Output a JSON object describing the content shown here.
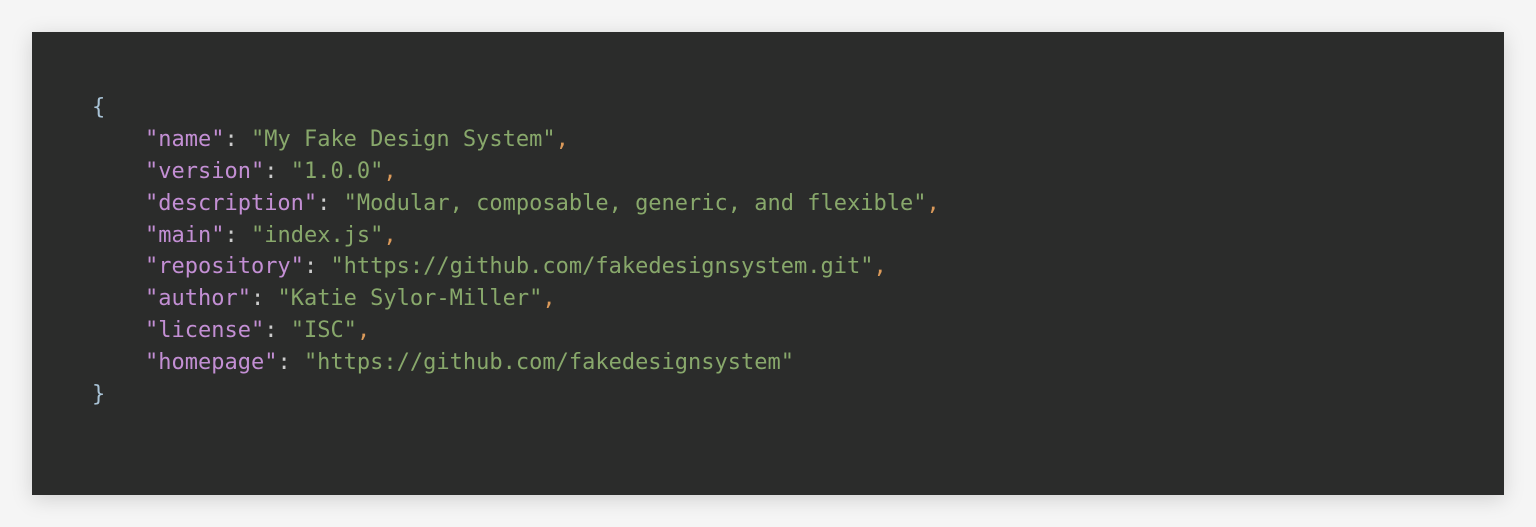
{
  "code": {
    "open_brace": "{",
    "close_brace": "}",
    "indent": "    ",
    "entries": [
      {
        "key": "\"name\"",
        "value": "\"My Fake Design System\"",
        "trailing_comma": true
      },
      {
        "key": "\"version\"",
        "value": "\"1.0.0\"",
        "trailing_comma": true
      },
      {
        "key": "\"description\"",
        "value": "\"Modular, composable, generic, and flexible\"",
        "trailing_comma": true
      },
      {
        "key": "\"main\"",
        "value": "\"index.js\"",
        "trailing_comma": true
      },
      {
        "key": "\"repository\"",
        "value": "\"https://github.com/fakedesignsystem.git\"",
        "trailing_comma": true
      },
      {
        "key": "\"author\"",
        "value": "\"Katie Sylor-Miller\"",
        "trailing_comma": true
      },
      {
        "key": "\"license\"",
        "value": "\"ISC\"",
        "trailing_comma": true
      },
      {
        "key": "\"homepage\"",
        "value": "\"https://github.com/fakedesignsystem\"",
        "trailing_comma": false
      }
    ]
  }
}
